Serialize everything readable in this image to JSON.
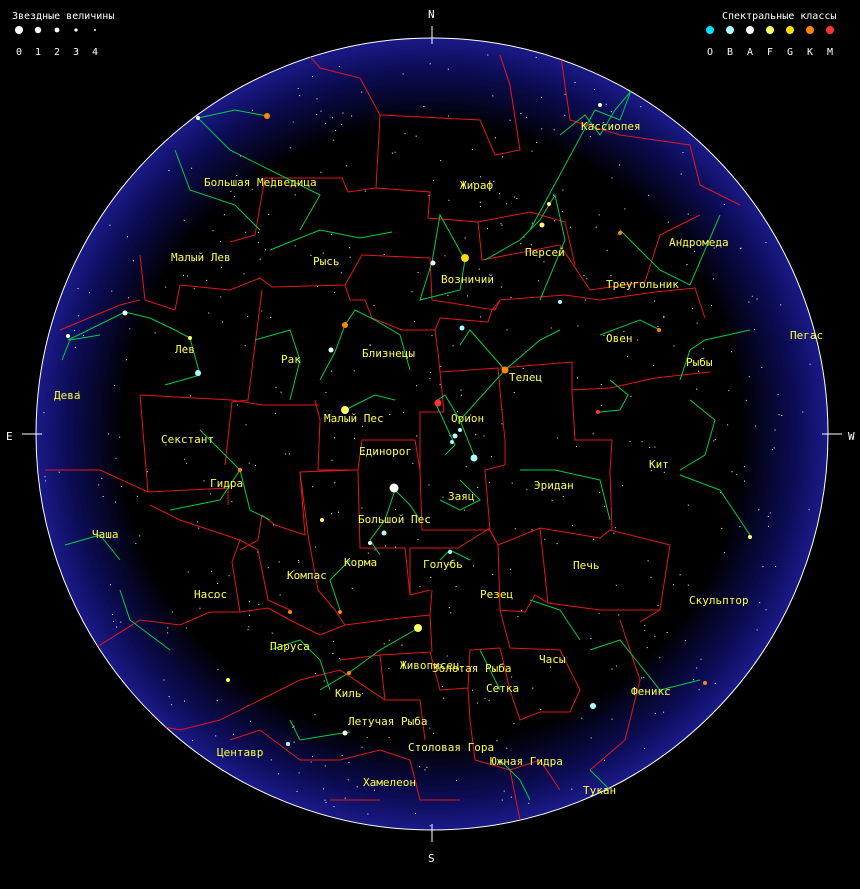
{
  "legend": {
    "magnitude_title": "Звездные величины",
    "magnitudes": [
      "0",
      "1",
      "2",
      "3",
      "4"
    ],
    "spectral_title": "Спектральные классы",
    "spectral_classes": [
      {
        "label": "O",
        "color": "#00e5ff"
      },
      {
        "label": "B",
        "color": "#aaffff"
      },
      {
        "label": "A",
        "color": "#ffffff"
      },
      {
        "label": "F",
        "color": "#ffff66"
      },
      {
        "label": "G",
        "color": "#ffdd00"
      },
      {
        "label": "K",
        "color": "#ff8800"
      },
      {
        "label": "M",
        "color": "#ff3333"
      }
    ]
  },
  "cardinals": {
    "north": "N",
    "south": "S",
    "east": "E",
    "west": "W"
  },
  "colors": {
    "sky": "#14147a",
    "boundaries": "#e01818",
    "constellation_lines": "#00cc44",
    "labels": "#ffff44",
    "horizon": "#ffffff"
  },
  "constellations": [
    "Кассиопея",
    "Большая Медведица",
    "Жираф",
    "Андромеда",
    "Персей",
    "Малый Лев",
    "Рысь",
    "Возничий",
    "Треугольник",
    "Пегас",
    "Лев",
    "Рак",
    "Близнецы",
    "Овен",
    "Рыбы",
    "Телец",
    "Дева",
    "Малый Пес",
    "Орион",
    "Секстант",
    "Единорог",
    "Кит",
    "Гидра",
    "Заяц",
    "Эридан",
    "Большой Пес",
    "Чаша",
    "Корма",
    "Голубь",
    "Печь",
    "Компас",
    "Насос",
    "Резец",
    "Скульптор",
    "Паруса",
    "Живописец",
    "Золотая Рыба",
    "Часы",
    "Киль",
    "Сетка",
    "Феникс",
    "Летучая Рыба",
    "Центавр",
    "Столовая Гора",
    "Южная Гидра",
    "Хамелеон",
    "Тукан"
  ]
}
